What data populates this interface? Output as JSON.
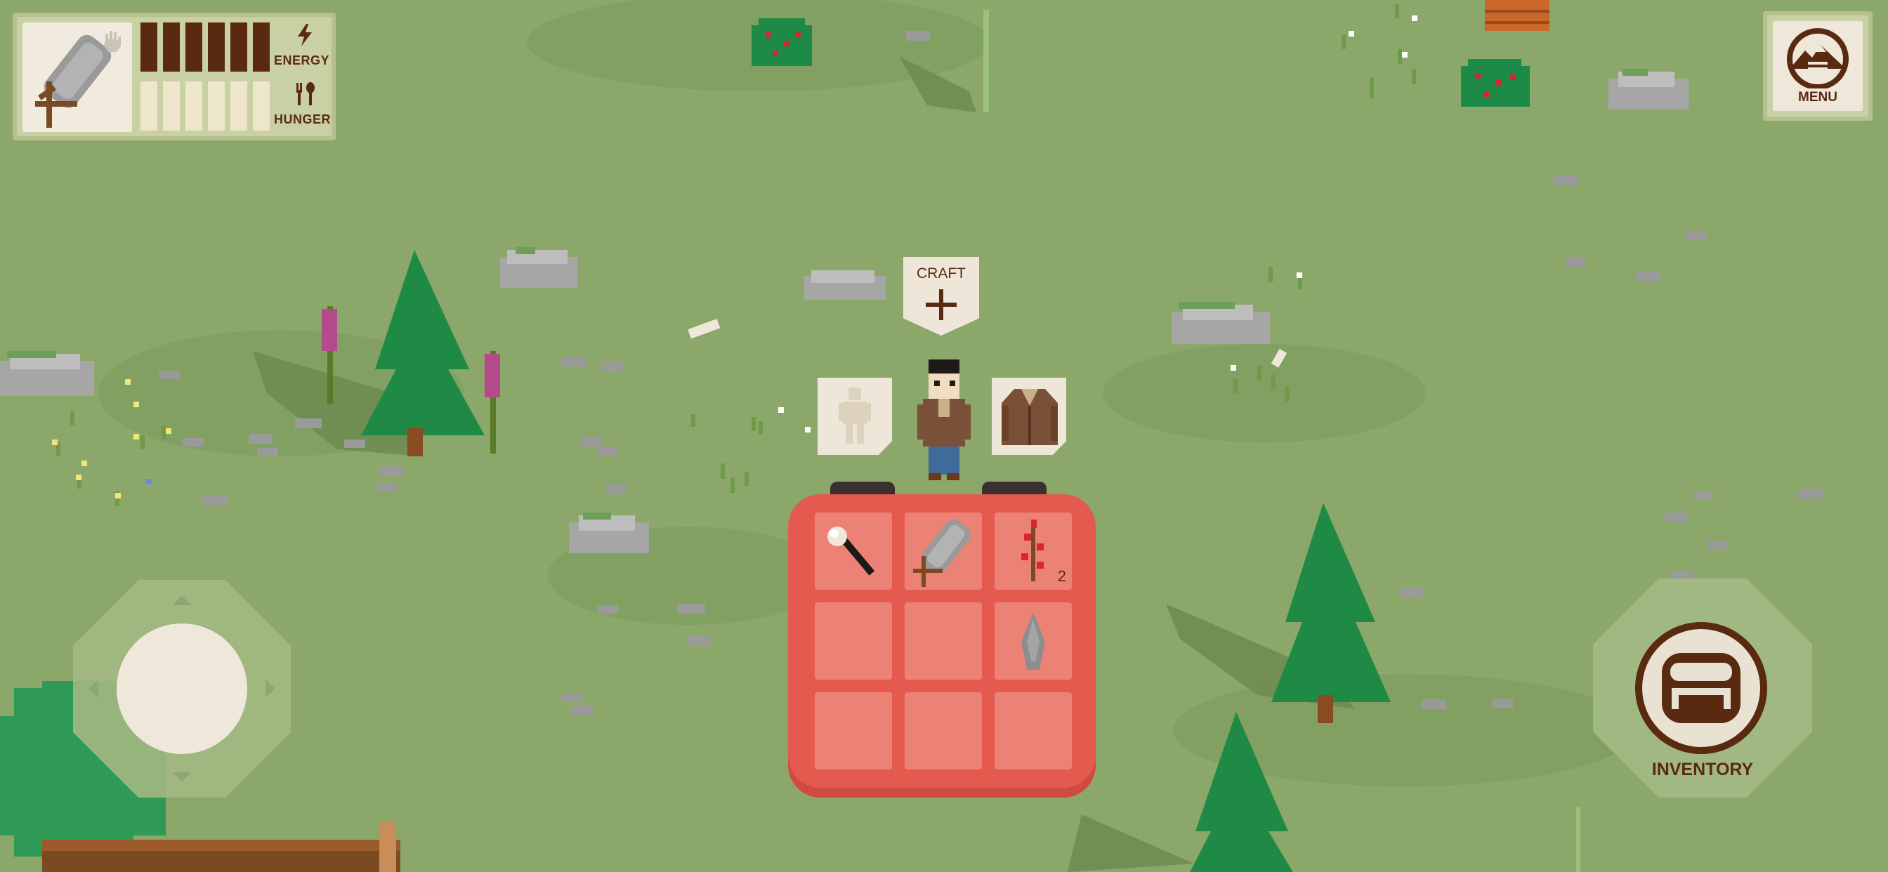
{
  "hud": {
    "equipped_item_icon": "stone-axe-icon",
    "energy": {
      "label": "ENERGY",
      "icon": "lightning-icon",
      "filled": 6,
      "max": 6
    },
    "hunger": {
      "label": "HUNGER",
      "icon": "fork-spoon-icon",
      "filled": 0,
      "max": 6
    }
  },
  "menu": {
    "label": "MENU",
    "icon": "mountain-menu-icon"
  },
  "craft": {
    "label": "CRAFT",
    "icon": "plus-icon"
  },
  "character_equip": {
    "left_slot_icon": "body-silhouette-icon",
    "right_slot_icon": "jacket-icon"
  },
  "inventory_button": {
    "label": "INVENTORY",
    "icon": "backpack-icon"
  },
  "backpack": {
    "slots": [
      {
        "item": "torch-icon",
        "count": ""
      },
      {
        "item": "stone-axe-icon",
        "count": ""
      },
      {
        "item": "red-berries-icon",
        "count": "2"
      },
      {
        "item": "",
        "count": ""
      },
      {
        "item": "",
        "count": ""
      },
      {
        "item": "flint-shard-icon",
        "count": ""
      },
      {
        "item": "",
        "count": ""
      },
      {
        "item": "",
        "count": ""
      },
      {
        "item": "",
        "count": ""
      }
    ]
  },
  "colors": {
    "grass": "#8ba86a",
    "hud_panel": "#c9d1a4",
    "hud_brown": "#5a2a10",
    "backpack_red": "#e55a4e",
    "pine_green": "#1f8a46"
  }
}
